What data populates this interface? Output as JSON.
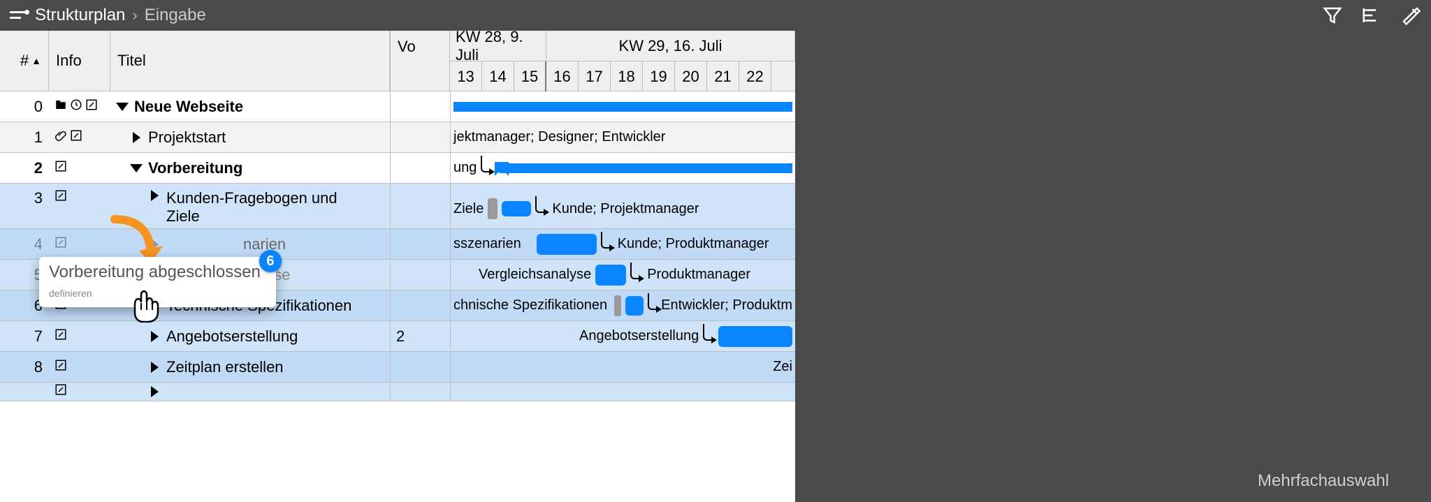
{
  "toolbar": {
    "breadcrumb_root": "Strukturplan",
    "breadcrumb_child": "Eingabe"
  },
  "headers": {
    "num": "#",
    "info": "Info",
    "title": "Titel",
    "vo": "Vo",
    "week1": "KW 28, 9. Juli",
    "week2": "KW 29, 16. Juli",
    "days": [
      "13",
      "14",
      "15",
      "16",
      "17",
      "18",
      "19",
      "20",
      "21",
      "22"
    ]
  },
  "rows": [
    {
      "n": "0",
      "title": "Neue Webseite",
      "bold": true,
      "disclosure": "down",
      "indent": 0,
      "icons": [
        "folder",
        "clock",
        "edit"
      ]
    },
    {
      "n": "1",
      "title": "Projektstart",
      "disclosure": "right",
      "indent": 1,
      "icons": [
        "clip",
        "edit"
      ],
      "tl_text": "jektmanager; Designer; Entwickler"
    },
    {
      "n": "2",
      "title": "Vorbereitung",
      "bold": true,
      "disclosure": "down",
      "indent": 1,
      "icons": [
        "edit"
      ],
      "tl_prefix": "ung"
    },
    {
      "n": "3",
      "title": "Kunden-Fragebogen und Ziele",
      "disclosure": "right",
      "indent": 2,
      "icons": [
        "edit"
      ],
      "sel": true,
      "wrap": true,
      "tl_label": "Ziele",
      "tl_assign": "Kunde; Projektmanager"
    },
    {
      "n": "4",
      "title": "narien",
      "disclosure": "right",
      "indent": 2,
      "icons": [
        "edit"
      ],
      "sel": true,
      "ghost": true,
      "tl_label": "sszenarien",
      "tl_assign": "Kunde; Produktmanager"
    },
    {
      "n": "5",
      "title": "Vergleichsanalyse",
      "disclosure": "right",
      "indent": 2,
      "icons": [
        "edit"
      ],
      "sel": true,
      "dim": true,
      "tl_label": "Vergleichsanalyse",
      "tl_assign": "Produktmanager"
    },
    {
      "n": "6",
      "title": "Technische Spezifikationen",
      "disclosure": "right",
      "indent": 2,
      "icons": [
        "edit"
      ],
      "sel": true,
      "tl_label": "chnische Spezifikationen",
      "tl_assign": "Entwickler; Produktm"
    },
    {
      "n": "7",
      "title": "Angebotserstellung",
      "disclosure": "right",
      "indent": 2,
      "icons": [
        "edit"
      ],
      "sel": true,
      "vo": "2",
      "tl_label": "Angebotserstellung"
    },
    {
      "n": "8",
      "title": "Zeitplan erstellen",
      "disclosure": "right",
      "indent": 2,
      "icons": [
        "edit"
      ],
      "sel": true,
      "tl_right_label": "Zei"
    }
  ],
  "ghost": {
    "label": "Vorbereitung abgeschlossen",
    "sub": "definieren",
    "badge": "6"
  },
  "sidebar": {
    "label": "Mehrfachauswahl"
  }
}
